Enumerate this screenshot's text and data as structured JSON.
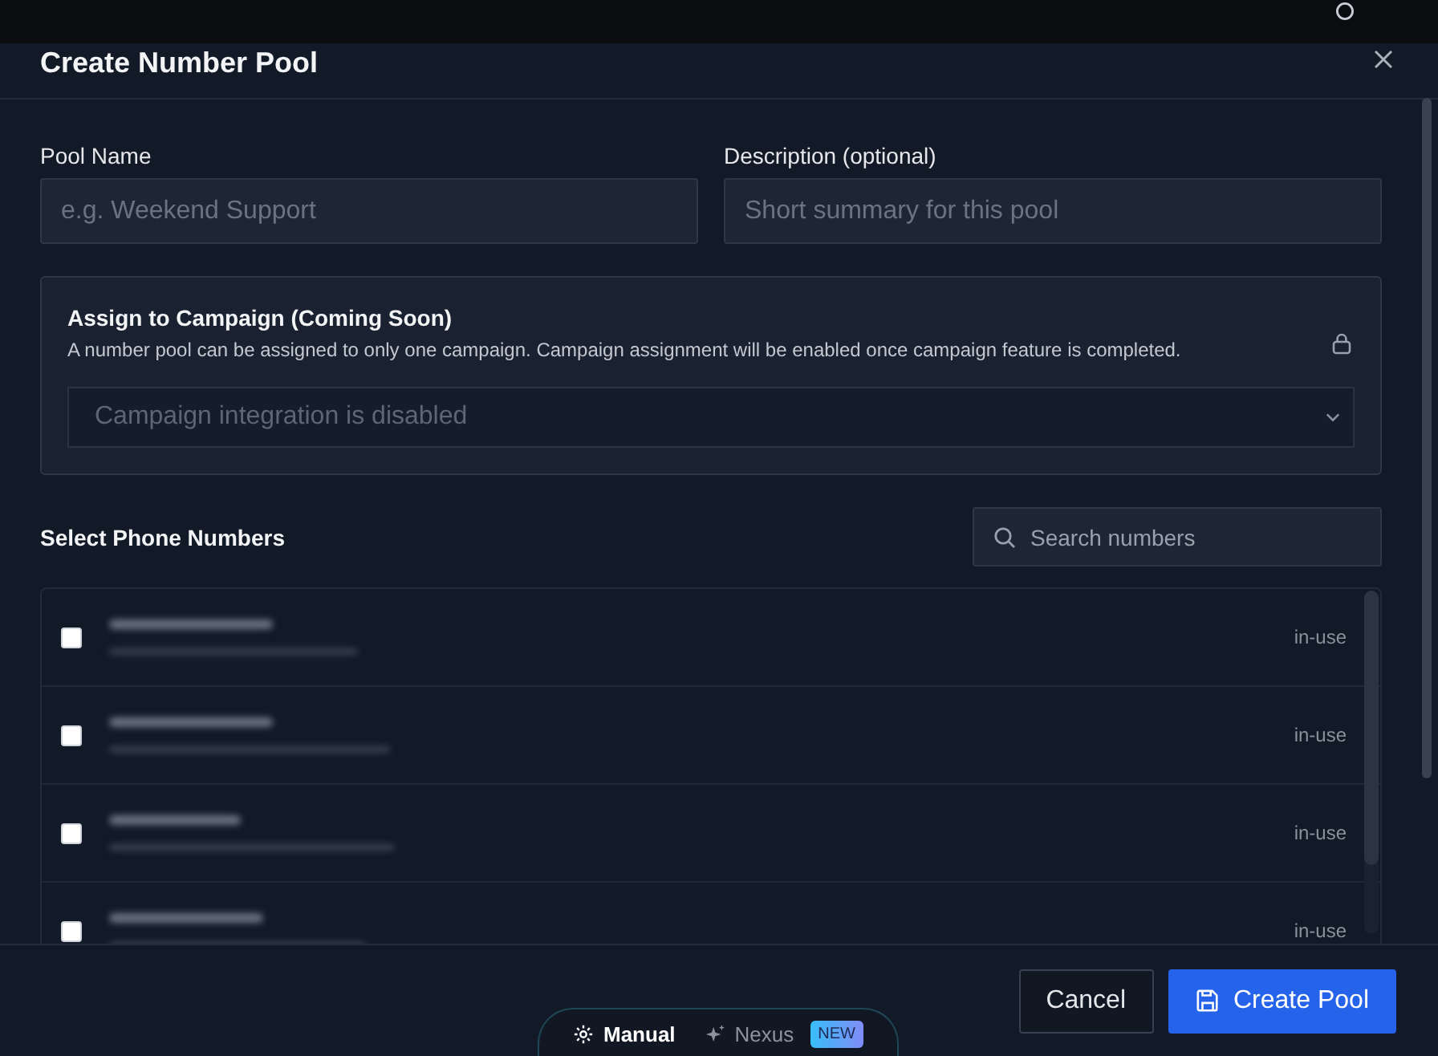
{
  "header": {
    "title": "Create Number Pool"
  },
  "fields": [
    {
      "label": "Pool Name",
      "placeholder": "e.g. Weekend Support"
    },
    {
      "label": "Description (optional)",
      "placeholder": "Short summary for this pool"
    }
  ],
  "campaign": {
    "title": "Assign to Campaign (Coming Soon)",
    "description": "A number pool can be assigned to only one campaign. Campaign assignment will be enabled once campaign feature is completed.",
    "locked": true,
    "select": {
      "placeholder": "Campaign integration is disabled",
      "disabled": true
    }
  },
  "phone_numbers": {
    "title": "Select Phone Numbers",
    "search": {
      "placeholder": "Search numbers"
    },
    "rows": [
      {
        "checked": false,
        "status": "in-use"
      },
      {
        "checked": false,
        "status": "in-use"
      },
      {
        "checked": false,
        "status": "in-use"
      },
      {
        "checked": false,
        "status": "in-use"
      }
    ]
  },
  "footer": {
    "buttons": [
      {
        "label": "Cancel",
        "kind": "secondary"
      },
      {
        "label": "Create Pool",
        "kind": "primary"
      }
    ]
  },
  "mode_switch": {
    "items": [
      {
        "label": "Manual",
        "selected": true
      },
      {
        "label": "Nexus",
        "selected": false,
        "badge": "NEW"
      }
    ]
  }
}
